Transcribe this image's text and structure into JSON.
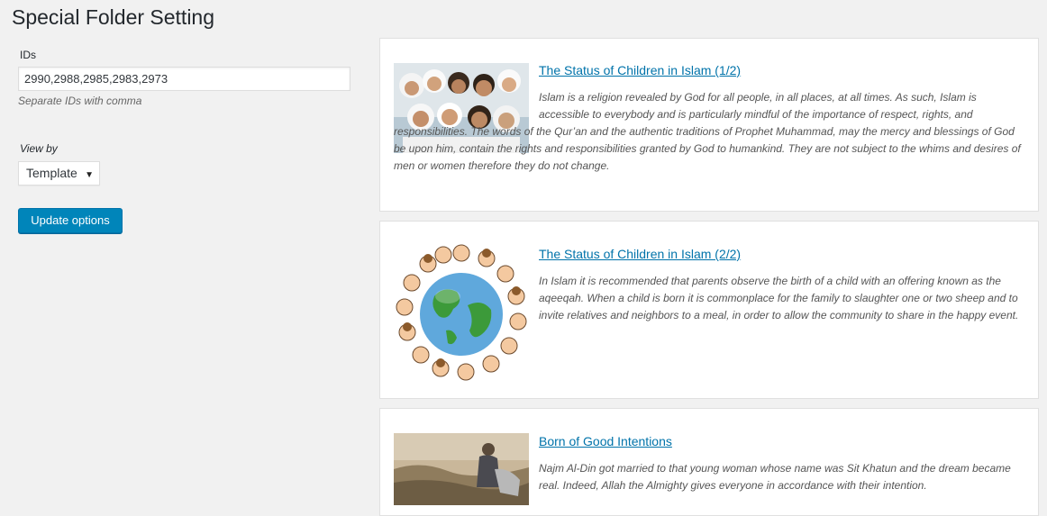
{
  "page": {
    "title": "Special Folder Setting"
  },
  "settings": {
    "ids_label": "IDs",
    "ids_value": "2990,2988,2985,2983,2973",
    "ids_hint": "Separate IDs with comma",
    "viewby_label": "View by",
    "viewby_value": "Template",
    "update_button": "Update options"
  },
  "posts": [
    {
      "title": "The Status of Children in Islam (1/2)",
      "excerpt": "Islam is a religion revealed by God for all people, in all places, at all times. As such, Islam is accessible to everybody and is particularly mindful of the importance of respect, rights, and responsibilities. The words of the Qur’an and the authentic traditions of Prophet Muhammad, may the mercy and blessings of God be upon him, contain the rights and responsibilities granted by God to humankind. They are not subject to the whims and desires of men or women therefore they do not change."
    },
    {
      "title": "The Status of Children in Islam (2/2)",
      "excerpt": "In Islam it is recommended that parents observe the birth of a child with an offering known as the aqeeqah. When a child is born it is commonplace for the family to slaughter one or two sheep and to invite relatives and neighbors to a meal, in order to allow the community to share in the happy event."
    },
    {
      "title": "Born of Good Intentions",
      "excerpt": "Najm Al-Din got married to that young woman whose name was Sit Khatun and the dream became real. Indeed, Allah the Almighty gives everyone in accordance with their intention."
    }
  ],
  "colors": {
    "link": "#0073aa",
    "button": "#0085ba"
  }
}
